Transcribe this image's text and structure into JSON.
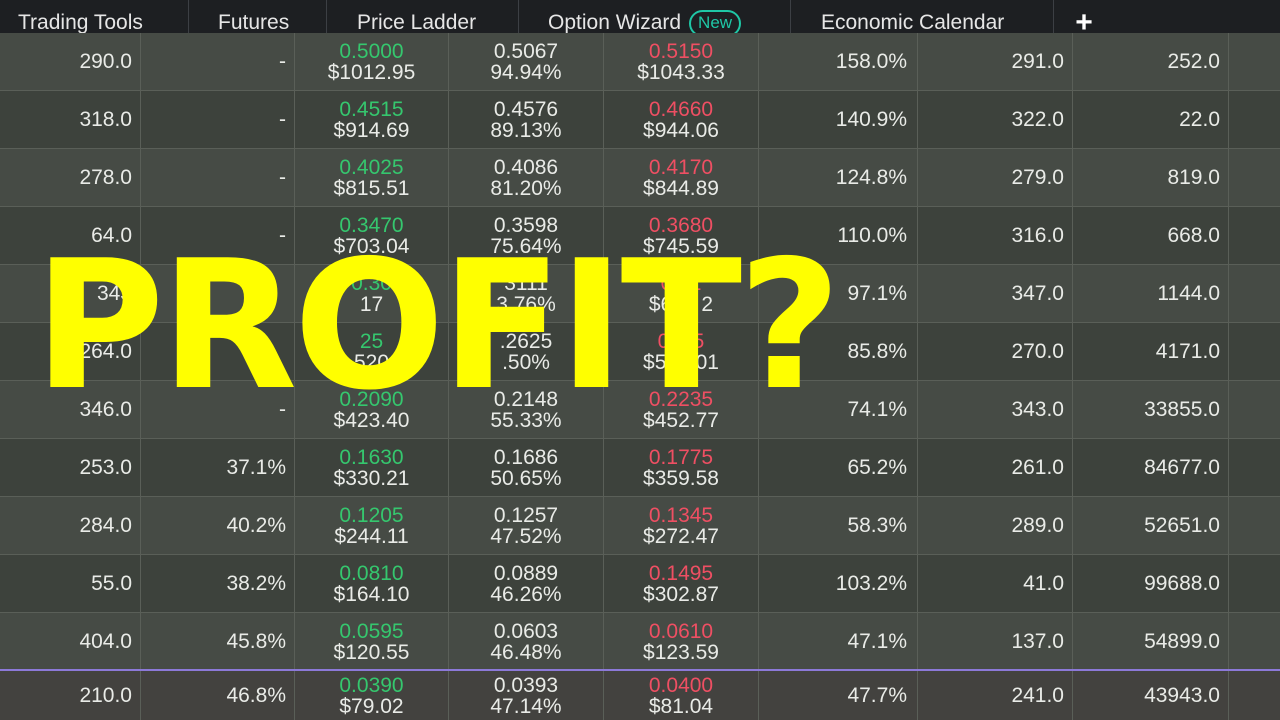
{
  "tabs": [
    {
      "label": "Trading Tools"
    },
    {
      "label": "Futures"
    },
    {
      "label": "Price Ladder"
    },
    {
      "label": "Option Wizard",
      "badge": "New"
    },
    {
      "label": "Economic Calendar"
    }
  ],
  "add_tab_label": "+",
  "overlay_text": "PROFIT?",
  "rows": [
    {
      "c0": "290.0",
      "c1": "-",
      "bid": "0.5000",
      "bid_val": "$1012.95",
      "mid": "0.5067",
      "mid_pct": "94.94%",
      "ask": "0.5150",
      "ask_val": "$1043.33",
      "c5": "158.0%",
      "c6": "291.0",
      "c7": "252.0"
    },
    {
      "c0": "318.0",
      "c1": "-",
      "bid": "0.4515",
      "bid_val": "$914.69",
      "mid": "0.4576",
      "mid_pct": "89.13%",
      "ask": "0.4660",
      "ask_val": "$944.06",
      "c5": "140.9%",
      "c6": "322.0",
      "c7": "22.0"
    },
    {
      "c0": "278.0",
      "c1": "-",
      "bid": "0.4025",
      "bid_val": "$815.51",
      "mid": "0.4086",
      "mid_pct": "81.20%",
      "ask": "0.4170",
      "ask_val": "$844.89",
      "c5": "124.8%",
      "c6": "279.0",
      "c7": "819.0"
    },
    {
      "c0": "64.0",
      "c1": "-",
      "bid": "0.3470",
      "bid_val": "$703.04",
      "mid": "0.3598",
      "mid_pct": "75.64%",
      "ask": "0.3680",
      "ask_val": "$745.59",
      "c5": "110.0%",
      "c6": "316.0",
      "c7": "668.0"
    },
    {
      "c0": "343",
      "c1": "",
      "bid": "0.30",
      "bid_val": "17",
      "mid": "3111",
      "mid_pct": "3.76%",
      "ask": "0.31",
      "ask_val": "$647 2",
      "c5": "97.1%",
      "c6": "347.0",
      "c7": "1144.0"
    },
    {
      "c0": "264.0",
      "c1": "",
      "bid": "25",
      "bid_val": "520",
      "mid": ".2625",
      "mid_pct": ".50%",
      "ask": "0. 15",
      "ask_val": "$550.01",
      "c5": "85.8%",
      "c6": "270.0",
      "c7": "4171.0"
    },
    {
      "c0": "346.0",
      "c1": "-",
      "bid": "0.2090",
      "bid_val": "$423.40",
      "mid": "0.2148",
      "mid_pct": "55.33%",
      "ask": "0.2235",
      "ask_val": "$452.77",
      "c5": "74.1%",
      "c6": "343.0",
      "c7": "33855.0"
    },
    {
      "c0": "253.0",
      "c1": "37.1%",
      "bid": "0.1630",
      "bid_val": "$330.21",
      "mid": "0.1686",
      "mid_pct": "50.65%",
      "ask": "0.1775",
      "ask_val": "$359.58",
      "c5": "65.2%",
      "c6": "261.0",
      "c7": "84677.0"
    },
    {
      "c0": "284.0",
      "c1": "40.2%",
      "bid": "0.1205",
      "bid_val": "$244.11",
      "mid": "0.1257",
      "mid_pct": "47.52%",
      "ask": "0.1345",
      "ask_val": "$272.47",
      "c5": "58.3%",
      "c6": "289.0",
      "c7": "52651.0"
    },
    {
      "c0": "55.0",
      "c1": "38.2%",
      "bid": "0.0810",
      "bid_val": "$164.10",
      "mid": "0.0889",
      "mid_pct": "46.26%",
      "ask": "0.1495",
      "ask_val": "$302.87",
      "c5": "103.2%",
      "c6": "41.0",
      "c7": "99688.0"
    },
    {
      "c0": "404.0",
      "c1": "45.8%",
      "bid": "0.0595",
      "bid_val": "$120.55",
      "mid": "0.0603",
      "mid_pct": "46.48%",
      "ask": "0.0610",
      "ask_val": "$123.59",
      "c5": "47.1%",
      "c6": "137.0",
      "c7": "54899.0"
    },
    {
      "c0": "210.0",
      "c1": "46.8%",
      "bid": "0.0390",
      "bid_val": "$79.02",
      "mid": "0.0393",
      "mid_pct": "47.14%",
      "ask": "0.0400",
      "ask_val": "$81.04",
      "c5": "47.7%",
      "c6": "241.0",
      "c7": "43943.0"
    }
  ],
  "colors": {
    "bid": "#35c76e",
    "ask": "#ef4f63",
    "overlay": "#ffff00",
    "badge": "#1fc7a6",
    "current_row_border": "#8c79d8"
  }
}
